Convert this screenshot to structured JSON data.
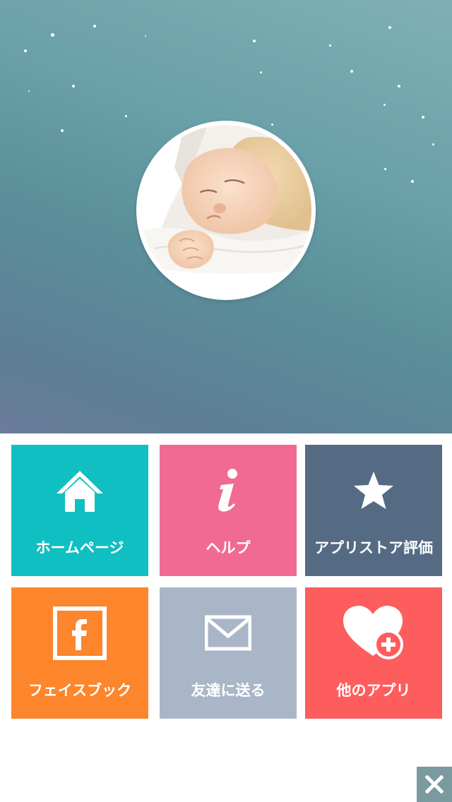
{
  "colors": {
    "homepage": "#10bfc1",
    "help": "#f06a93",
    "rate": "#556b84",
    "facebook": "#fd852b",
    "share": "#a9b6c8",
    "more_apps": "#fd5d5d",
    "close": "#7b9aa0"
  },
  "hero": {
    "image_alt": "sleeping baby"
  },
  "menu": {
    "homepage": {
      "label": "ホームページ",
      "icon": "home-icon"
    },
    "help": {
      "label": "ヘルプ",
      "icon": "info-icon"
    },
    "rate": {
      "label": "アプリストア評価",
      "icon": "star-icon"
    },
    "facebook": {
      "label": "フェイスブック",
      "icon": "facebook-icon"
    },
    "share": {
      "label": "友達に送る",
      "icon": "mail-icon"
    },
    "more_apps": {
      "label": "他のアプリ",
      "icon": "heart-plus-icon"
    }
  },
  "close": {
    "icon": "close-icon"
  }
}
